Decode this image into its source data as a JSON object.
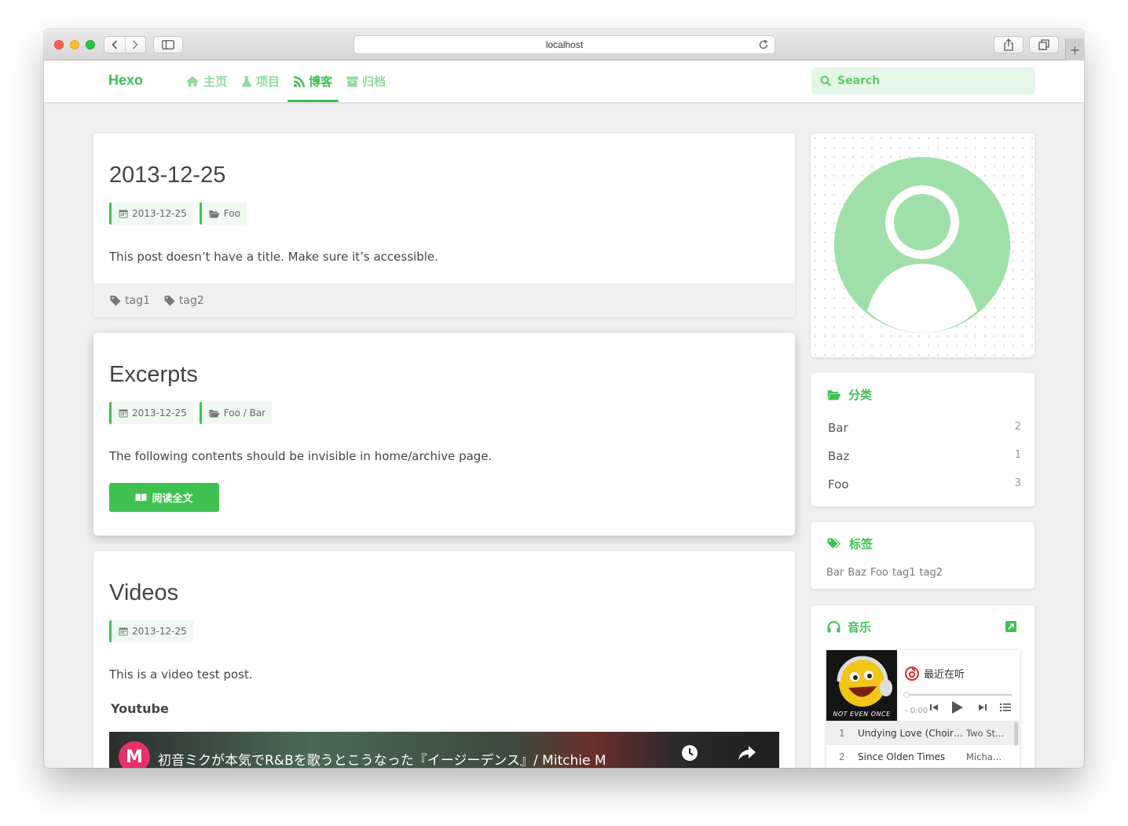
{
  "browser": {
    "url": "localhost",
    "new_tab_icon": "+"
  },
  "nav": {
    "brand": "Hexo",
    "items": [
      {
        "label": "主页",
        "icon": "home-icon"
      },
      {
        "label": "项目",
        "icon": "flask-icon"
      },
      {
        "label": "博客",
        "icon": "rss-icon",
        "active": true
      },
      {
        "label": "归档",
        "icon": "archive-icon"
      }
    ],
    "search_placeholder": "Search"
  },
  "posts": [
    {
      "title": "2013-12-25",
      "date": "2013-12-25",
      "category": "Foo",
      "excerpt": "This post doesn’t have a title. Make sure it’s accessible.",
      "tags": [
        "tag1",
        "tag2"
      ]
    },
    {
      "title": "Excerpts",
      "date": "2013-12-25",
      "category": "Foo / Bar",
      "excerpt": "The following contents should be invisible in home/archive page.",
      "read_more": "阅读全文"
    },
    {
      "title": "Videos",
      "date": "2013-12-25",
      "excerpt": "This is a video test post.",
      "subheading": "Youtube",
      "video_title": "初音ミクが本気でR&Bを歌うとこうなった『イージーデンス』/ Mitchie M",
      "video_logo": "M"
    }
  ],
  "sidebar": {
    "categories": {
      "title": "分类",
      "items": [
        {
          "name": "Bar",
          "count": "2"
        },
        {
          "name": "Baz",
          "count": "1"
        },
        {
          "name": "Foo",
          "count": "3"
        }
      ]
    },
    "tags": {
      "title": "标签",
      "items": [
        "Bar",
        "Baz",
        "Foo",
        "tag1",
        "tag2"
      ]
    },
    "music": {
      "title": "音乐",
      "now_playing": "最近在听",
      "cover_label": "NOT EVEN ONCE",
      "time": "- 0:00",
      "progress": 0,
      "playlist": [
        {
          "num": "1",
          "name": "Undying Love (Choir…",
          "artist": "Two St…"
        },
        {
          "num": "2",
          "name": "Since Olden Times",
          "artist": "Michae…"
        }
      ]
    }
  },
  "colors": {
    "accent": "#3fc152",
    "accent_light": "#92d99c",
    "avatar": "#9fe0a8"
  }
}
